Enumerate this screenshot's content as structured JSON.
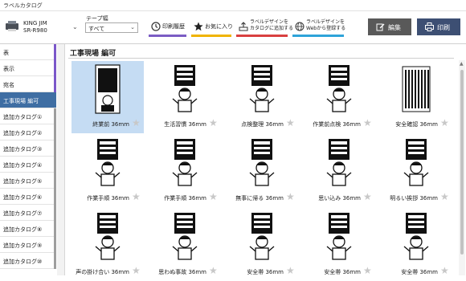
{
  "window": {
    "title": "ラベルカタログ"
  },
  "printer": {
    "name_line1": "KING JIM",
    "name_line2": "SR-R980",
    "dropdown_glyph": "⌄",
    "icon": "printer-icon"
  },
  "tape": {
    "label": "テープ幅",
    "selected": "すべて"
  },
  "toolbar": {
    "history": {
      "label": "印刷履歴",
      "icon": "history-icon",
      "color": "#7b5cc4"
    },
    "favorites": {
      "label": "お気に入り",
      "icon": "star-icon",
      "color": "#f0b400"
    },
    "send_catalog": {
      "line1": "ラベルデザインを",
      "line2": "カタログに追加する",
      "icon": "upload-icon",
      "color": "#d94040"
    },
    "web_register": {
      "line1": "ラベルデザインを",
      "line2": "Webから登録する",
      "icon": "globe-icon",
      "color": "#2ea3d9"
    },
    "edit": {
      "label": "編集",
      "icon": "edit-icon"
    },
    "print": {
      "label": "印刷",
      "icon": "print-icon"
    }
  },
  "sidebar": {
    "items": [
      {
        "label": "表",
        "stripe": "#7b57c9"
      },
      {
        "label": "表示",
        "stripe": "#7b57c9"
      },
      {
        "label": "宛名",
        "stripe": "#7b57c9"
      },
      {
        "label": "工事現場 編可",
        "stripe": "#3f6ea3",
        "active": true
      },
      {
        "label": "追加カタログ①",
        "stripe": "#9e9e9e"
      },
      {
        "label": "追加カタログ②",
        "stripe": "#9e9e9e"
      },
      {
        "label": "追加カタログ③",
        "stripe": "#9e9e9e"
      },
      {
        "label": "追加カタログ④",
        "stripe": "#9e9e9e"
      },
      {
        "label": "追加カタログ⑤",
        "stripe": "#9e9e9e"
      },
      {
        "label": "追加カタログ⑥",
        "stripe": "#9e9e9e"
      },
      {
        "label": "追加カタログ⑦",
        "stripe": "#9e9e9e"
      },
      {
        "label": "追加カタログ⑧",
        "stripe": "#9e9e9e"
      },
      {
        "label": "追加カタログ⑨",
        "stripe": "#9e9e9e"
      },
      {
        "label": "追加カタログ⑩",
        "stripe": "#9e9e9e"
      }
    ]
  },
  "category": {
    "title": "工事現場 編可"
  },
  "labels": [
    {
      "caption": "終業前 36mm",
      "selected": true,
      "art": "poster",
      "text": "終業前に確認を"
    },
    {
      "caption": "生活習慣 36mm",
      "art": "worker",
      "text": "乱れたケガの元"
    },
    {
      "caption": "点検整理 36mm",
      "art": "worker",
      "text": "忘れず点検整理"
    },
    {
      "caption": "作業前点検 36mm",
      "art": "worker",
      "text": "作業前点検"
    },
    {
      "caption": "安全確認 36mm",
      "art": "bars",
      "text": ""
    },
    {
      "caption": "作業手順 36mm",
      "art": "worker",
      "text": "作業手順"
    },
    {
      "caption": "作業手順 36mm",
      "art": "worker",
      "text": "再確認"
    },
    {
      "caption": "無事に帰る 36mm",
      "art": "worker",
      "text": "無事に帰ろう"
    },
    {
      "caption": "思い込み 36mm",
      "art": "worker",
      "text": "思い込み"
    },
    {
      "caption": "明るい挨拶 36mm",
      "art": "worker",
      "text": "明るく"
    },
    {
      "caption": "声の掛け合い 36mm",
      "art": "worker",
      "text": "みんなで声掛け"
    },
    {
      "caption": "思わぬ事故 36mm",
      "art": "worker",
      "text": "思わぬ事故"
    },
    {
      "caption": "安全帯 36mm",
      "art": "worker",
      "text": "安全帯"
    },
    {
      "caption": "安全帯 36mm",
      "art": "worker",
      "text": "安全帯"
    },
    {
      "caption": "安全帯 36mm",
      "art": "worker",
      "text": "安全帯"
    }
  ],
  "colors": {
    "accent": "#3f6ea3",
    "selection": "#c5dcf3",
    "star": "#c8c8c8"
  }
}
